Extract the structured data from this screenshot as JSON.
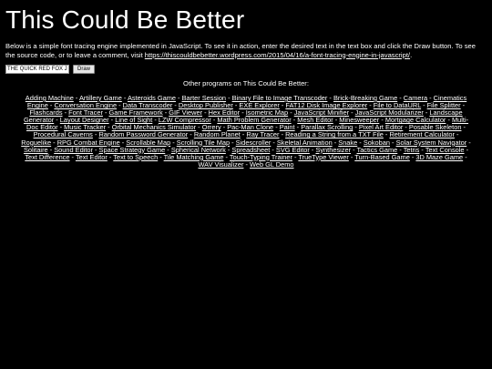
{
  "header": {
    "title": "This Could Be Better"
  },
  "intro": {
    "text": "Below is a simple font tracing engine implemented in JavaScript. To see it in action, enter the desired text in the text box and click the Draw button. To see the source code, or to leave a comment, visit ",
    "link_text": "https://thiscouldbebetter.wordpress.com/2015/04/16/a-font-tracing-engine-in-javascript/",
    "trailing": "."
  },
  "controls": {
    "text_value": "THE QUICK RED FOX JUMPS OVER THE LAZY BROWN DOG",
    "draw_label": "Draw"
  },
  "programs": {
    "heading": "Other programs on This Could Be Better:",
    "separator": " - ",
    "items": [
      "Adding Machine",
      "Artillery Game",
      "Asteroids Game",
      "Barter Session",
      "Binary File to Image Transcoder",
      "Brick-Breaking Game",
      "Camera",
      "Cinematics Engine",
      "Conversation Engine",
      "Data Transcoder",
      "Desktop Publisher",
      "EXE Explorer",
      "FAT12 Disk Image Explorer",
      "File to DataURL",
      "File Splitter",
      "Flashcards",
      "Font Tracer",
      "Game Framework",
      "GIF Viewer",
      "Hex Editor",
      "Isometric Map",
      "JavaScript Minifier",
      "JavaScript Modularizer",
      "Landscape Generator",
      "Layout Designer",
      "Line of Sight",
      "LZW Compressor",
      "Math Problem Generator",
      "Mesh Editor",
      "Minesweeper",
      "Mortgage Calculator",
      "Multi-Doc Editor",
      "Music Tracker",
      "Orbital Mechanics Simulator",
      "Orrery",
      "Pac-Man Clone",
      "Paint",
      "Parallax Scrolling",
      "Pixel Art Editor",
      "Posable Skeleton",
      "Procedural Caverns",
      "Random Password Generator",
      "Random Planet",
      "Ray Tracer",
      "Reading a String from a TXT File",
      "Retirement Calculator",
      "Roguelike",
      "RPG Combat Engine",
      "Scrollable Map",
      "Scrolling Tile Map",
      "Sidescroller",
      "Skeletal Animation",
      "Snake",
      "Sokoban",
      "Solar System Navigator",
      "Solitaire",
      "Sound Editor",
      "Space Strategy Game",
      "Spherical Network",
      "Spreadsheet",
      "SVG Editor",
      "Synthesizer",
      "Tactics Game",
      "Tetris",
      "Text Console",
      "Text Difference",
      "Text Editor",
      "Text to Speech",
      "Tile Matching Game",
      "Touch-Typing Trainer",
      "TrueType Viewer",
      "Turn-Based Game",
      "3D Maze Game",
      "WAV Visualizer",
      "Web GL Demo"
    ]
  }
}
